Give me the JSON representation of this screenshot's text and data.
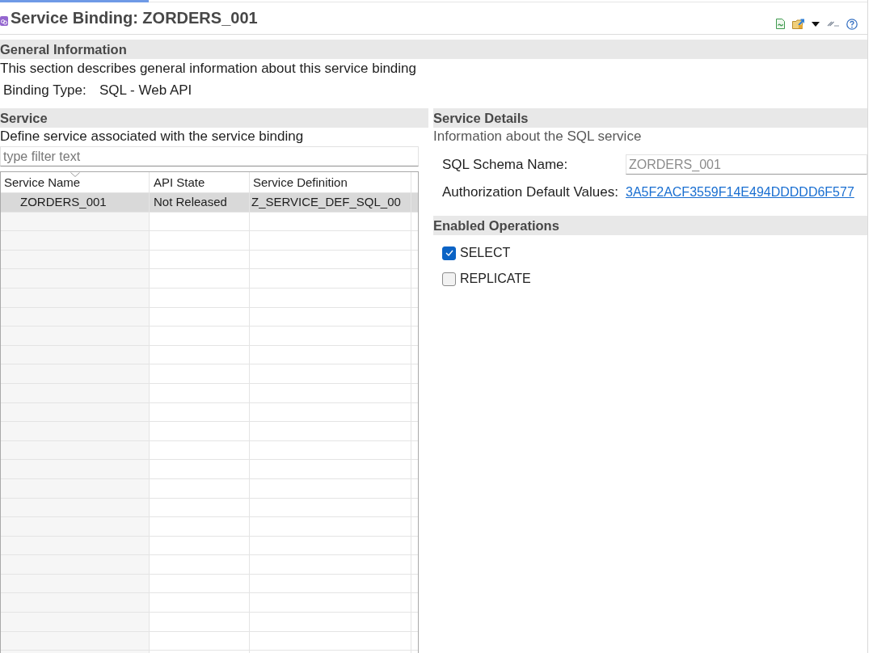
{
  "editor": {
    "title": "Service Binding: ZORDERS_001"
  },
  "general_information": {
    "heading": "General Information",
    "description": "This section describes general information about this service binding",
    "binding_type": {
      "label": "Binding Type:",
      "value": "SQL - Web API"
    }
  },
  "service": {
    "heading": "Service",
    "description": "Define service associated with the service binding",
    "filter": {
      "placeholder": "type filter text"
    },
    "table": {
      "columns": [
        {
          "label": "Service Name",
          "sorted": true
        },
        {
          "label": "API State",
          "sorted": false
        },
        {
          "label": "Service Definition",
          "sorted": false
        }
      ],
      "rows": [
        {
          "cells": [
            "ZORDERS_001",
            "Not Released",
            "Z_SERVICE_DEF_SQL_00"
          ],
          "selected": true
        }
      ]
    }
  },
  "service_details": {
    "heading": "Service Details",
    "description": "Information about the SQL service",
    "fields": [
      {
        "kind": "text",
        "label": "SQL Schema Name:",
        "value": "ZORDERS_001",
        "disabled": true
      },
      {
        "kind": "link",
        "label": "Authorization Default Values:",
        "value": "3A5F2ACF3559F14E494DDDDD6F577"
      }
    ]
  },
  "enabled_operations": {
    "heading": "Enabled Operations",
    "options": [
      {
        "label": "SELECT",
        "checked": true
      },
      {
        "label": "REPLICATE",
        "checked": false
      }
    ]
  }
}
